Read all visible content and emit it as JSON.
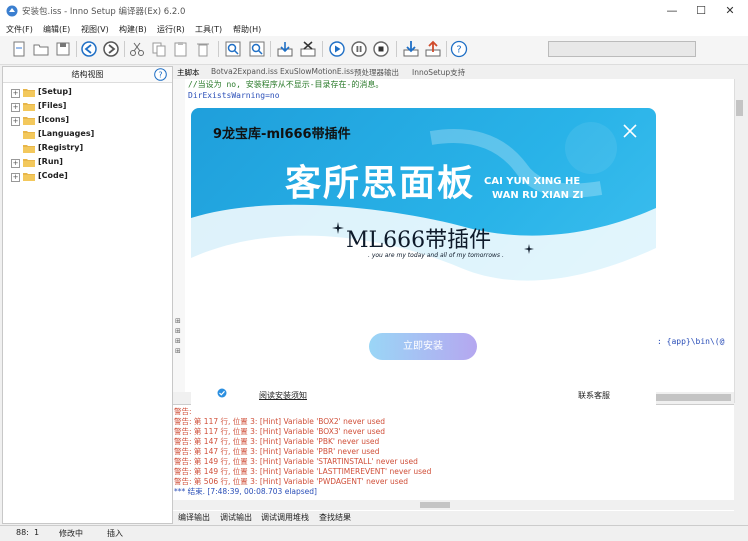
{
  "window": {
    "title": "安装包.iss - Inno Setup 编译器(Ex) 6.2.0",
    "minimize_glyph": "—",
    "maximize_glyph": "☐",
    "close_glyph": "✕"
  },
  "menu": {
    "items": [
      "文件(F)",
      "编辑(E)",
      "视图(V)",
      "构建(B)",
      "运行(R)",
      "工具(T)",
      "帮助(H)"
    ]
  },
  "toolbar": {
    "icons": [
      "new-file-icon",
      "open-folder-icon",
      "save-icon",
      "back-icon",
      "forward-icon",
      "cut-icon",
      "copy-icon",
      "paste-icon",
      "delete-icon",
      "find-icon",
      "find-next-icon",
      "compile-icon",
      "stop-compile-icon",
      "run-icon",
      "pause-icon",
      "stop-icon",
      "download-icon",
      "upload-icon",
      "help-icon"
    ]
  },
  "left_panel": {
    "title": "结构视图",
    "help_glyph": "?",
    "tree": [
      {
        "label": "[Setup]",
        "expandable": true
      },
      {
        "label": "[Files]",
        "expandable": true
      },
      {
        "label": "[Icons]",
        "expandable": true
      },
      {
        "label": "[Languages]",
        "expandable": false
      },
      {
        "label": "[Registry]",
        "expandable": false
      },
      {
        "label": "[Run]",
        "expandable": true
      },
      {
        "label": "[Code]",
        "expandable": true
      }
    ]
  },
  "editor": {
    "tabs": [
      "主脚本",
      "Botva2Expand.iss",
      "ExuSlowMotionE.iss",
      "预处理器输出",
      "InnoSetup支持"
    ],
    "lines": {
      "comment": "//当设为 no, 安装程序从不显示-目录存在-的消息。",
      "directive": "DirExistsWarning=no",
      "fragment": ": {app}\\bin\\(@"
    },
    "gutter_marks": [
      "⊞",
      "⊞",
      "⊞",
      "⊞"
    ]
  },
  "output": {
    "lines": [
      "警告:",
      "警告: 第 117 行, 位置 3: [Hint] Variable 'BOX2' never used",
      "警告: 第 117 行, 位置 3: [Hint] Variable 'BOX3' never used",
      "警告: 第 147 行, 位置 3: [Hint] Variable 'PBK' never used",
      "警告: 第 147 行, 位置 3: [Hint] Variable 'PBR' never used",
      "警告: 第 149 行, 位置 3: [Hint] Variable 'STARTINSTALL' never used",
      "警告: 第 149 行, 位置 3: [Hint] Variable 'LASTTIMEREVENT' never used",
      "警告: 第 506 行, 位置 3: [Hint] Variable 'PWDAGENT' never used"
    ],
    "done": "*** 结束. [7:48:39, 00:08.703 elapsed]"
  },
  "bottom_tabs": [
    "编译输出",
    "调试输出",
    "调试调用堆栈",
    "查找结果"
  ],
  "status": {
    "position": "88:",
    "column": "1",
    "modified": "修改中",
    "mode": "插入"
  },
  "popup": {
    "title": "9龙宝库-ml666带插件",
    "close_glyph": "✕",
    "headline": "客所思面板",
    "pinyin_line1": "CAI YUN XING HE",
    "pinyin_line2": "WAN RU XIAN ZI",
    "brand": "ML666带插件",
    "tagline": ". you are my today and all of my tomorrows .",
    "install_button": "立即安装",
    "agreement_link": "阅读安装须知",
    "contact_link": "联系客服"
  },
  "colors": {
    "popup_blue": "#29b3e8",
    "warning_text": "#d0503a",
    "code_comment": "#2a7a2a",
    "code_keyword": "#2b4fb8"
  }
}
